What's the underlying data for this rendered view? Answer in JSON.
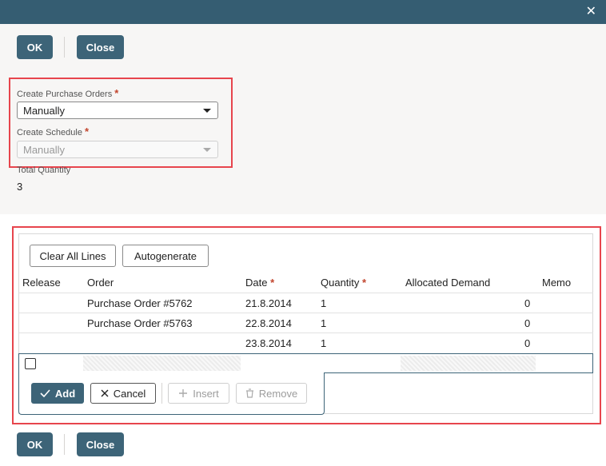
{
  "dialog": {
    "close_icon": "close-icon"
  },
  "toolbar": {
    "ok_label": "OK",
    "close_label": "Close"
  },
  "form": {
    "create_po_label": "Create Purchase Orders",
    "create_po_value": "Manually",
    "create_schedule_label": "Create Schedule",
    "create_schedule_value": "Manually",
    "required_marker": "*",
    "total_quantity_label": "Total Quantity",
    "total_quantity_value": "3"
  },
  "lines": {
    "clear_all_label": "Clear All Lines",
    "autogenerate_label": "Autogenerate",
    "columns": {
      "release": "Release",
      "order": "Order",
      "date": "Date",
      "quantity": "Quantity",
      "allocated_demand": "Allocated Demand",
      "memo": "Memo"
    },
    "rows": [
      {
        "release": "",
        "order": "Purchase Order #5762",
        "date": "21.8.2014",
        "quantity": "1",
        "allocated_demand": "0",
        "memo": ""
      },
      {
        "release": "",
        "order": "Purchase Order #5763",
        "date": "22.8.2014",
        "quantity": "1",
        "allocated_demand": "0",
        "memo": ""
      },
      {
        "release": "",
        "order": "",
        "date": "23.8.2014",
        "quantity": "1",
        "allocated_demand": "0",
        "memo": ""
      }
    ],
    "actions": {
      "add": "Add",
      "cancel": "Cancel",
      "insert": "Insert",
      "remove": "Remove"
    }
  },
  "colors": {
    "header": "#355d72",
    "primary_button": "#3d6478",
    "highlight_border": "#e7454d",
    "required": "#c2452d"
  }
}
